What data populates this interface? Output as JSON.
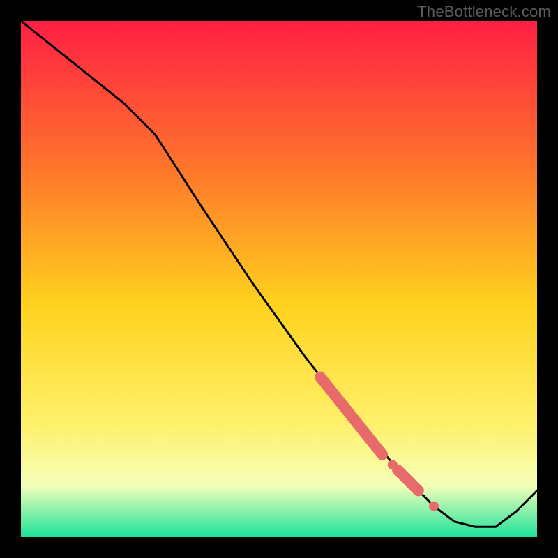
{
  "watermark": "TheBottleneck.com",
  "colors": {
    "frame": "#000000",
    "gradient_top": "#ff1f44",
    "gradient_mid1": "#ff7a2a",
    "gradient_mid2": "#ffd21e",
    "gradient_mid3": "#fff06a",
    "gradient_mid4": "#f4ffb8",
    "gradient_bot": "#1de29b",
    "line": "#000000",
    "marker": "#e86b6b"
  },
  "chart_data": {
    "type": "line",
    "title": "",
    "xlabel": "",
    "ylabel": "",
    "xlim": [
      0,
      100
    ],
    "ylim": [
      0,
      100
    ],
    "grid": false,
    "legend": false,
    "series": [
      {
        "name": "curve",
        "x": [
          0,
          10,
          20,
          26,
          35,
          45,
          55,
          62,
          68,
          74,
          80,
          84,
          88,
          92,
          96,
          100
        ],
        "y": [
          100,
          92,
          84,
          78,
          64,
          49,
          35,
          26,
          19,
          12,
          6,
          3,
          2,
          2,
          5,
          9
        ]
      }
    ],
    "markers": [
      {
        "name": "highlight-segment-upper",
        "type": "thick-segment",
        "x": [
          58,
          70
        ],
        "y": [
          31,
          16
        ]
      },
      {
        "name": "highlight-dot-1",
        "type": "dot",
        "x": 72,
        "y": 14
      },
      {
        "name": "highlight-segment-lower",
        "type": "thick-segment",
        "x": [
          73,
          77
        ],
        "y": [
          13,
          9
        ]
      },
      {
        "name": "highlight-dot-2",
        "type": "dot",
        "x": 80,
        "y": 6
      }
    ]
  }
}
